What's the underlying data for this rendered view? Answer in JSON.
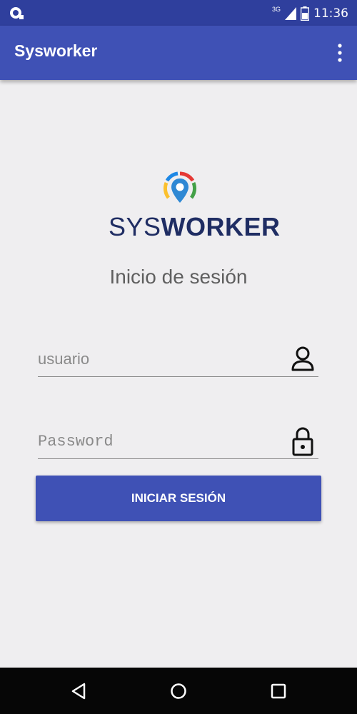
{
  "status_bar": {
    "network": "3G",
    "time": "11:36",
    "icons": [
      "notification-icon",
      "signal-icon",
      "battery-icon"
    ]
  },
  "app_bar": {
    "title": "Sysworker",
    "overflow_icon": "more-vert-icon"
  },
  "logo": {
    "text_light": "SYS",
    "text_bold": "WORKER",
    "colors": [
      "#e53935",
      "#43a047",
      "#fbc02d",
      "#1e88e5"
    ]
  },
  "login": {
    "title": "Inicio de sesión",
    "username_placeholder": "usuario",
    "password_placeholder": "Password",
    "submit_label": "INICIAR SESIÓN"
  },
  "nav_bar": {
    "icons": [
      "back-icon",
      "home-icon",
      "recents-icon"
    ]
  },
  "colors": {
    "primary": "#3f51b5",
    "primary_dark": "#2f3f9d",
    "background": "#efeef0",
    "logo_text": "#1f2d63"
  }
}
